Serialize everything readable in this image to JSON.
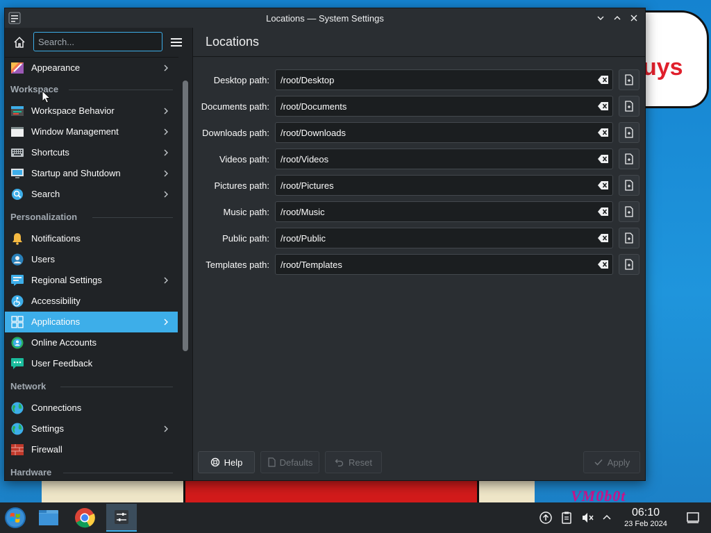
{
  "window": {
    "title": "Locations — System Settings"
  },
  "sidebar": {
    "search_placeholder": "Search...",
    "items": [
      {
        "id": "appearance",
        "label": "Appearance",
        "icon": "appearance-icon",
        "chevron": true
      },
      {
        "id": "workspace-behavior",
        "label": "Workspace Behavior",
        "icon": "workspace-behavior-icon",
        "chevron": true
      },
      {
        "id": "window-management",
        "label": "Window Management",
        "icon": "window-management-icon",
        "chevron": true
      },
      {
        "id": "shortcuts",
        "label": "Shortcuts",
        "icon": "keyboard-icon",
        "chevron": true
      },
      {
        "id": "startup-shutdown",
        "label": "Startup and Shutdown",
        "icon": "startup-icon",
        "chevron": true
      },
      {
        "id": "search",
        "label": "Search",
        "icon": "search-icon",
        "chevron": true
      },
      {
        "id": "notifications",
        "label": "Notifications",
        "icon": "bell-icon",
        "chevron": false
      },
      {
        "id": "users",
        "label": "Users",
        "icon": "users-icon",
        "chevron": false
      },
      {
        "id": "regional-settings",
        "label": "Regional Settings",
        "icon": "regional-icon",
        "chevron": true
      },
      {
        "id": "accessibility",
        "label": "Accessibility",
        "icon": "accessibility-icon",
        "chevron": false
      },
      {
        "id": "applications",
        "label": "Applications",
        "icon": "applications-icon",
        "chevron": true,
        "active": true
      },
      {
        "id": "online-accounts",
        "label": "Online Accounts",
        "icon": "online-accounts-icon",
        "chevron": false
      },
      {
        "id": "user-feedback",
        "label": "User Feedback",
        "icon": "feedback-icon",
        "chevron": false
      },
      {
        "id": "connections",
        "label": "Connections",
        "icon": "globe-icon",
        "chevron": false
      },
      {
        "id": "network-settings",
        "label": "Settings",
        "icon": "globe-icon",
        "chevron": true
      },
      {
        "id": "firewall",
        "label": "Firewall",
        "icon": "firewall-icon",
        "chevron": false
      }
    ],
    "sections": {
      "workspace": "Workspace",
      "personalization": "Personalization",
      "network": "Network",
      "hardware": "Hardware"
    }
  },
  "content": {
    "title": "Locations",
    "rows": [
      {
        "label": "Desktop path:",
        "value": "/root/Desktop"
      },
      {
        "label": "Documents path:",
        "value": "/root/Documents"
      },
      {
        "label": "Downloads path:",
        "value": "/root/Downloads"
      },
      {
        "label": "Videos path:",
        "value": "/root/Videos"
      },
      {
        "label": "Pictures path:",
        "value": "/root/Pictures"
      },
      {
        "label": "Music path:",
        "value": "/root/Music"
      },
      {
        "label": "Public path:",
        "value": "/root/Public"
      },
      {
        "label": "Templates path:",
        "value": "/root/Templates"
      }
    ]
  },
  "footer": {
    "help": "Help",
    "defaults": "Defaults",
    "reset": "Reset",
    "apply": "Apply"
  },
  "taskbar": {
    "time": "06:10",
    "date": "23 Feb 2024"
  },
  "wallpaper": {
    "bubble_text": "uys",
    "scrawl_text": "VM0b0t"
  },
  "colors": {
    "accent": "#3daee9",
    "window_bg": "#202326",
    "content_bg": "#2a2e32"
  }
}
